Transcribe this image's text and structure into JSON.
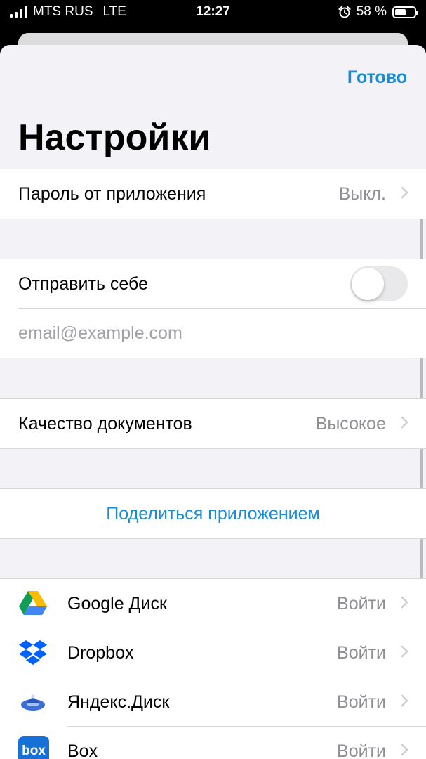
{
  "status_bar": {
    "carrier": "MTS RUS",
    "network": "LTE",
    "time": "12:27",
    "battery": "58 %",
    "battery_level": 0.58,
    "icons": [
      "signal-icon",
      "alarm-icon",
      "battery-icon"
    ]
  },
  "header": {
    "done_label": "Готово",
    "title": "Настройки"
  },
  "settings": {
    "app_password": {
      "label": "Пароль от приложения",
      "value": "Выкл."
    },
    "send_to_self": {
      "label": "Отправить себе",
      "enabled": false
    },
    "email": {
      "value": "",
      "placeholder": "email@example.com"
    },
    "doc_quality": {
      "label": "Качество документов",
      "value": "Высокое"
    },
    "share_app": {
      "label": "Поделиться приложением"
    }
  },
  "services": [
    {
      "name": "Google Диск",
      "action": "Войти",
      "icon": "google-drive-icon"
    },
    {
      "name": "Dropbox",
      "action": "Войти",
      "icon": "dropbox-icon"
    },
    {
      "name": "Яндекс.Диск",
      "action": "Войти",
      "icon": "yandex-disk-icon"
    },
    {
      "name": "Box",
      "action": "Войти",
      "icon": "box-icon",
      "icon_text": "box"
    }
  ],
  "colors": {
    "accent": "#1a8bd6",
    "background": "#f2f2f7",
    "secondary_text": "#8e8e93",
    "box_brand": "#1770d6",
    "dropbox_brand": "#0061fe"
  }
}
